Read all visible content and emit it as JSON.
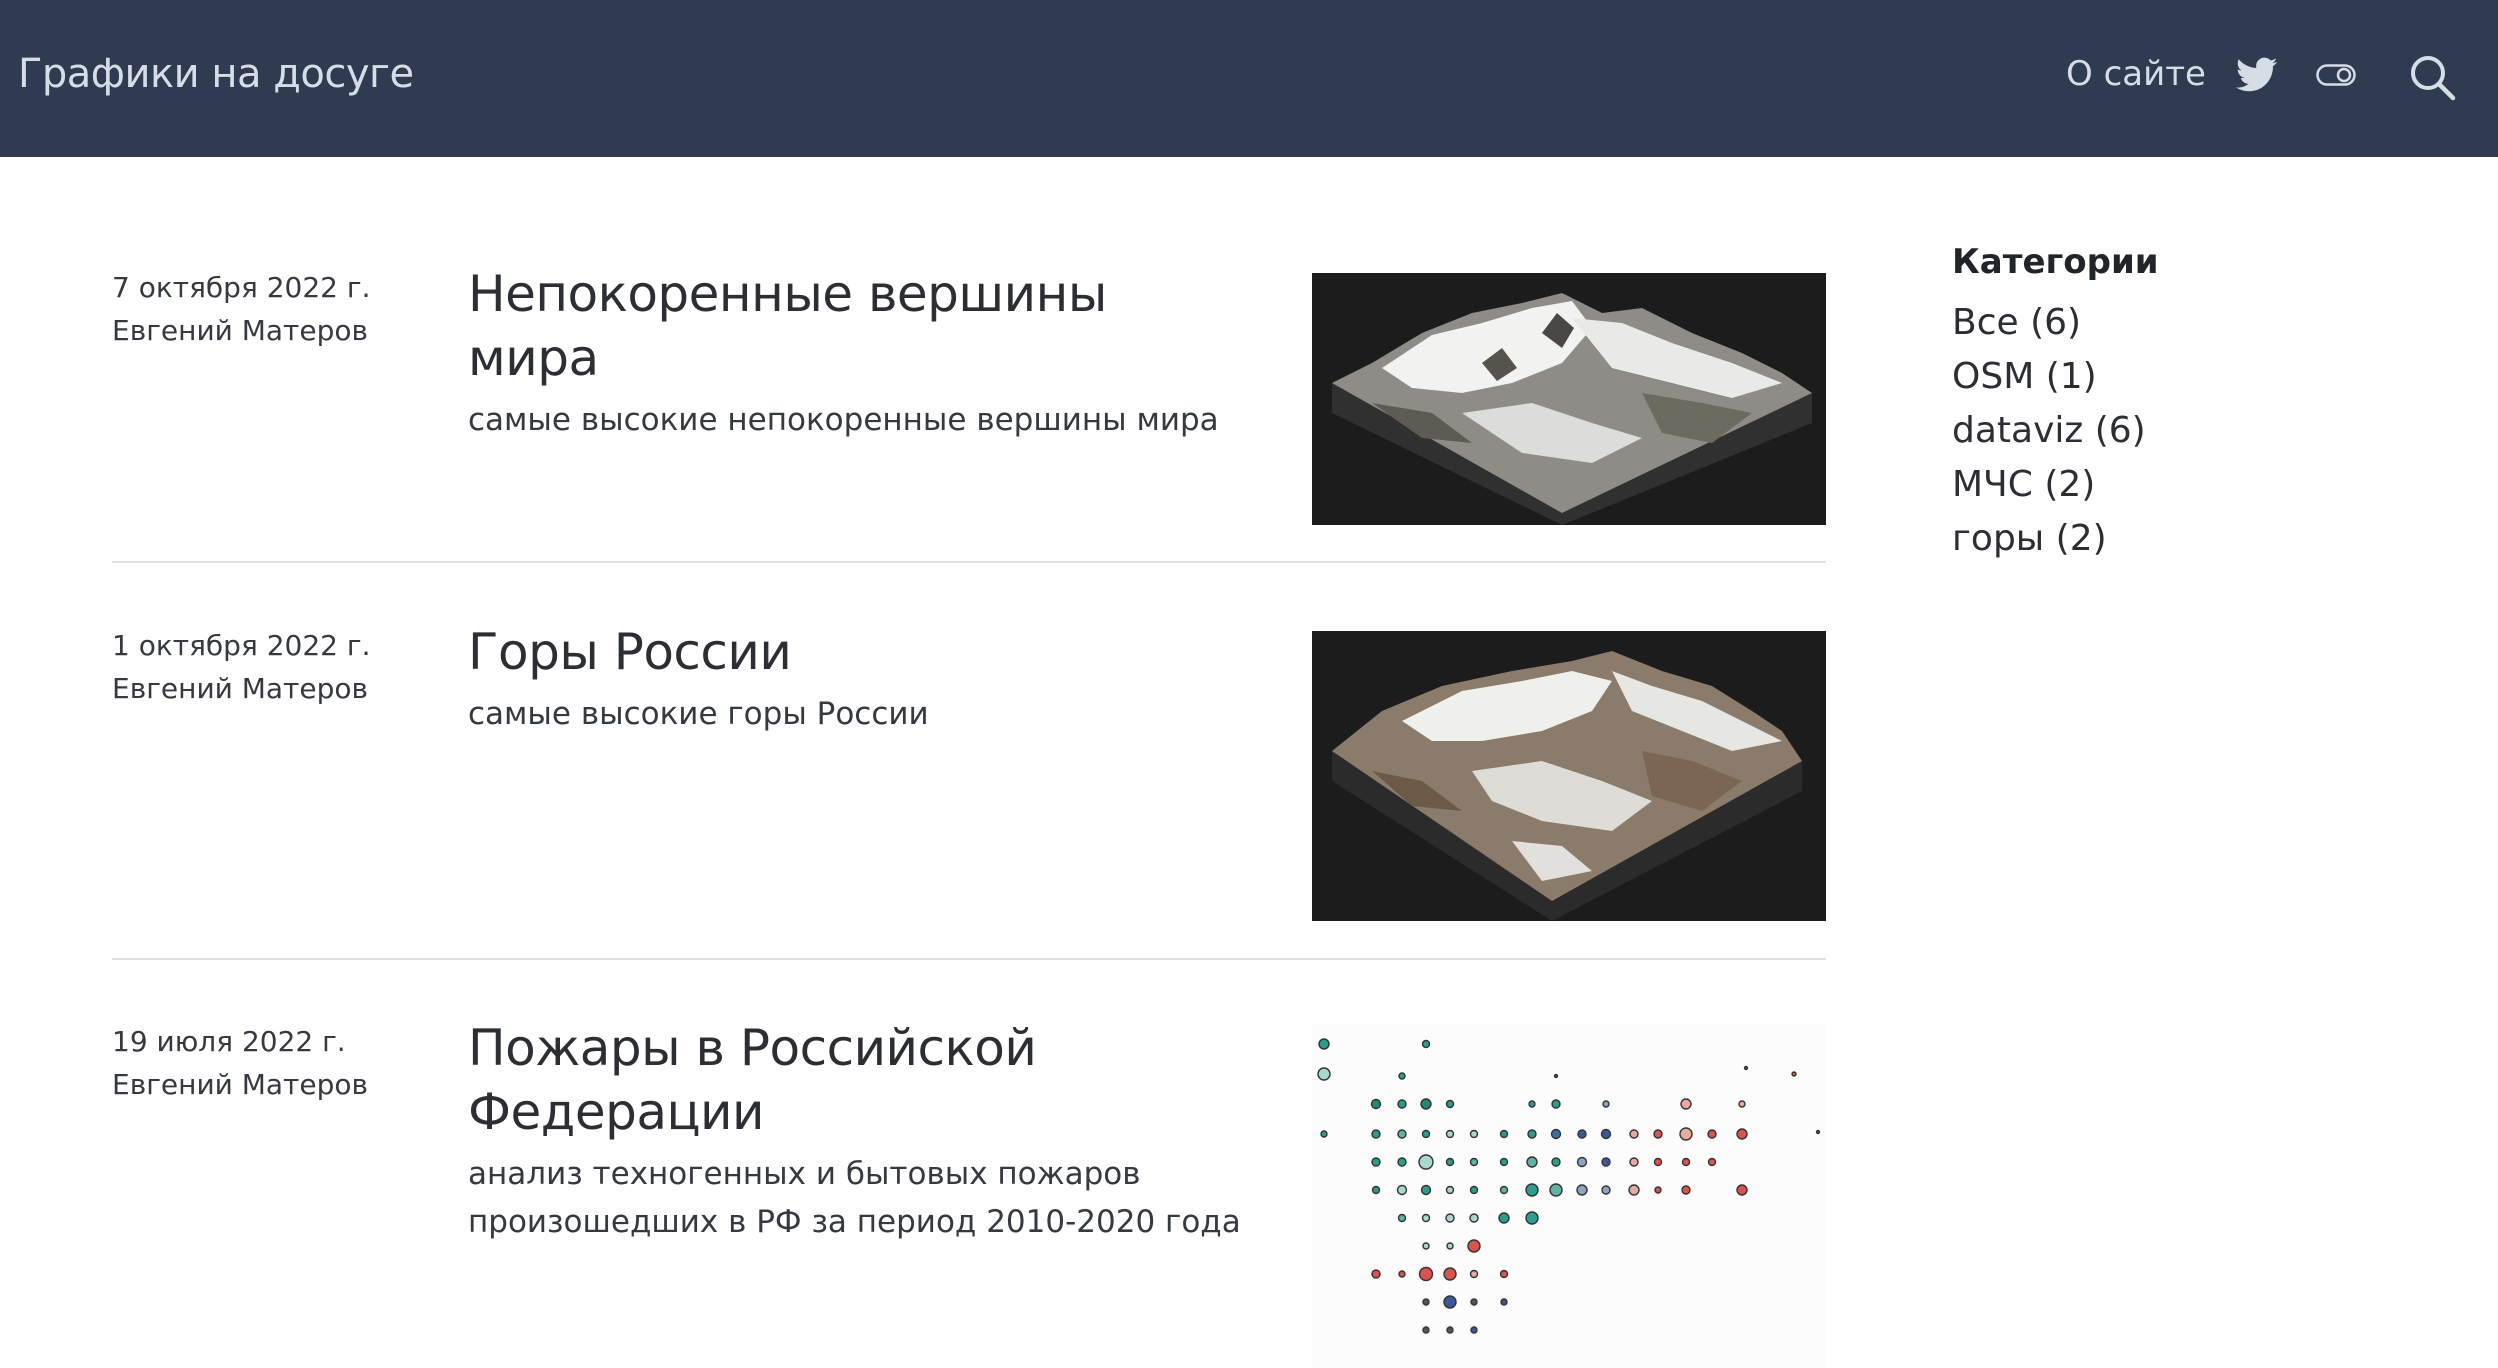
{
  "nav": {
    "brand": "Графики на досуге",
    "about": "О сайте",
    "icons": [
      "twitter-icon",
      "theme-toggle-icon",
      "search-icon"
    ]
  },
  "posts": [
    {
      "date": "7 октября 2022 г.",
      "author": "Евгений Матеров",
      "title": "Непокоренные вершины мира",
      "description": "самые высокие непокоренные вершины мира",
      "thumbnail": "mountain-3d-render"
    },
    {
      "date": "1 октября 2022 г.",
      "author": "Евгений Матеров",
      "title": "Горы России",
      "description": "самые высокие горы России",
      "thumbnail": "mountain-3d-render"
    },
    {
      "date": "19 июля 2022 г.",
      "author": "Евгений Матеров",
      "title": "Пожары в Российской Федерации",
      "description": "анализ техногенных и бытовых пожаров произошедших в РФ за период 2010-2020 года",
      "thumbnail": "regions-bubble-map"
    }
  ],
  "sidebar": {
    "title": "Категории",
    "categories": [
      {
        "label": "Все (6)"
      },
      {
        "label": "OSM (1)"
      },
      {
        "label": "dataviz (6)"
      },
      {
        "label": "МЧС (2)"
      },
      {
        "label": "горы (2)"
      }
    ]
  },
  "colors": {
    "navbar": "#2e3b50",
    "nav_text": "#d7dde6",
    "thumb_bg": "#1c1c1c",
    "bubble_teal": "#2a9d8f",
    "bubble_red": "#d9534f",
    "bubble_blue": "#3b5998"
  }
}
